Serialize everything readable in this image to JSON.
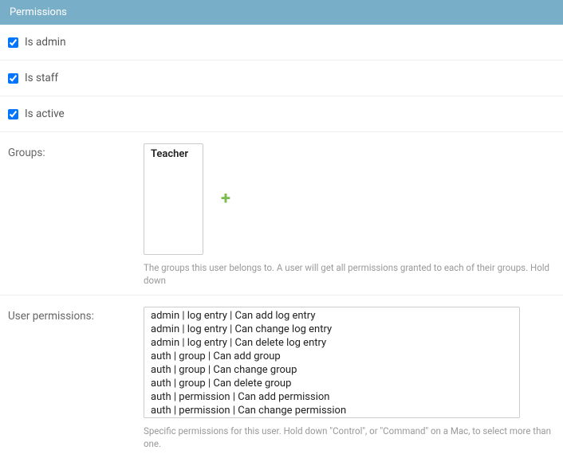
{
  "header": {
    "title": "Permissions"
  },
  "checkboxes": {
    "is_admin": {
      "label": "Is admin",
      "checked": true
    },
    "is_staff": {
      "label": "Is staff",
      "checked": true
    },
    "is_active": {
      "label": "Is active",
      "checked": true
    }
  },
  "groups": {
    "label": "Groups:",
    "options": [
      "Teacher"
    ],
    "help": "The groups this user belongs to. A user will get all permissions granted to each of their groups. Hold down"
  },
  "user_permissions": {
    "label": "User permissions:",
    "options": [
      "admin | log entry | Can add log entry",
      "admin | log entry | Can change log entry",
      "admin | log entry | Can delete log entry",
      "auth | group | Can add group",
      "auth | group | Can change group",
      "auth | group | Can delete group",
      "auth | permission | Can add permission",
      "auth | permission | Can change permission"
    ],
    "help": "Specific permissions for this user. Hold down \"Control\", or \"Command\" on a Mac, to select more than one."
  }
}
